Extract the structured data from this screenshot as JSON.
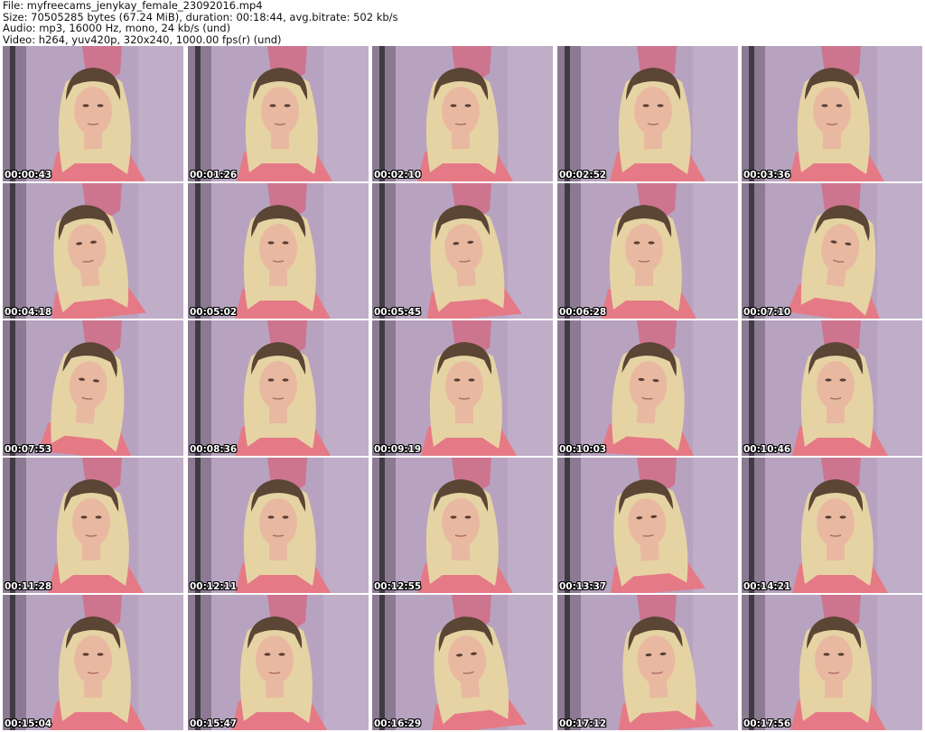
{
  "header": {
    "file_line": "File: myfreecams_jenykay_female_23092016.mp4",
    "size_line": "Size: 70505285 bytes (67.24 MiB), duration: 00:18:44, avg.bitrate: 502 kb/s",
    "audio_line": "Audio: mp3, 16000 Hz, mono, 24 kb/s (und)",
    "video_line": "Video: h264, yuv420p, 320x240, 1000.00 fps(r) (und)"
  },
  "thumbnails": [
    {
      "timestamp": "00:00:43"
    },
    {
      "timestamp": "00:01:26"
    },
    {
      "timestamp": "00:02:10"
    },
    {
      "timestamp": "00:02:52"
    },
    {
      "timestamp": "00:03:36"
    },
    {
      "timestamp": "00:04:18"
    },
    {
      "timestamp": "00:05:02"
    },
    {
      "timestamp": "00:05:45"
    },
    {
      "timestamp": "00:06:28"
    },
    {
      "timestamp": "00:07:10"
    },
    {
      "timestamp": "00:07:53"
    },
    {
      "timestamp": "00:08:36"
    },
    {
      "timestamp": "00:09:19"
    },
    {
      "timestamp": "00:10:03"
    },
    {
      "timestamp": "00:10:46"
    },
    {
      "timestamp": "00:11:28"
    },
    {
      "timestamp": "00:12:11"
    },
    {
      "timestamp": "00:12:55"
    },
    {
      "timestamp": "00:13:37"
    },
    {
      "timestamp": "00:14:21"
    },
    {
      "timestamp": "00:15:04"
    },
    {
      "timestamp": "00:15:47"
    },
    {
      "timestamp": "00:16:29"
    },
    {
      "timestamp": "00:17:12"
    },
    {
      "timestamp": "00:17:56"
    }
  ],
  "colors": {
    "wall": "#b7a3bf",
    "wall_dark": "#8c7a92",
    "door_frame": "#3f3b44",
    "pink_object": "#cf6f8a",
    "hair_dark": "#5b4534",
    "hair_blonde": "#e6d3a4",
    "skin": "#e8b9a0",
    "shirt": "#e57a86"
  }
}
